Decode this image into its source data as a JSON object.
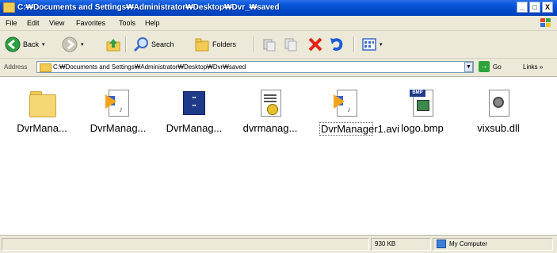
{
  "window": {
    "title": "C:₩Documents and Settings₩Administrator₩Desktop₩Dvr_₩saved",
    "minimize": "_",
    "maximize": "□",
    "close": "X"
  },
  "menu": [
    "File",
    "Edit",
    "View",
    "Favorites",
    "Tools",
    "Help"
  ],
  "toolbar": {
    "back_label": "Back",
    "search_label": "Search",
    "folders_label": "Folders"
  },
  "address": {
    "label": "Address",
    "value": "C:₩Documents and Settings₩Administrator₩Desktop₩Dvr₩saved",
    "go_label": "Go",
    "links_label": "Links »"
  },
  "files": [
    {
      "name": "DvrMana...",
      "icon": "folder-icon"
    },
    {
      "name": "DvrManag...",
      "icon": "media-file-icon"
    },
    {
      "name": "DvrManag...",
      "icon": "application-icon"
    },
    {
      "name": "dvrmanag...",
      "icon": "config-file-icon"
    },
    {
      "name": "DvrManager1.avi",
      "icon": "avi-video-icon",
      "selected": true
    },
    {
      "name": "logo.bmp",
      "icon": "bmp-image-icon"
    },
    {
      "name": "vixsub.dll",
      "icon": "dll-file-icon"
    }
  ],
  "status": {
    "size": "930 KB",
    "location": "My Computer"
  }
}
